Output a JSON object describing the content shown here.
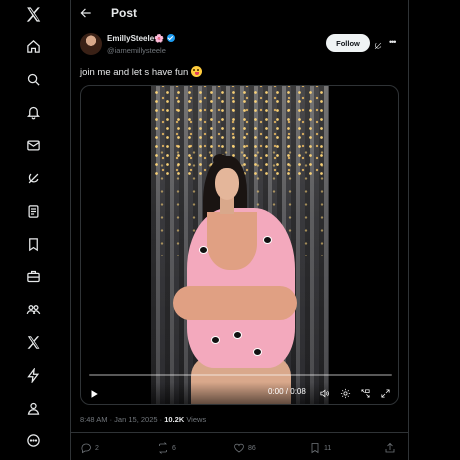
{
  "sidebar": {
    "items": [
      {
        "icon": "x-logo-icon"
      },
      {
        "icon": "home-icon"
      },
      {
        "icon": "search-icon"
      },
      {
        "icon": "notifications-icon"
      },
      {
        "icon": "messages-icon"
      },
      {
        "icon": "grok-icon"
      },
      {
        "icon": "lists-icon"
      },
      {
        "icon": "bookmarks-icon"
      },
      {
        "icon": "jobs-icon"
      },
      {
        "icon": "communities-icon"
      },
      {
        "icon": "premium-icon"
      },
      {
        "icon": "verified-orgs-icon"
      },
      {
        "icon": "profile-icon"
      },
      {
        "icon": "more-icon"
      }
    ]
  },
  "header": {
    "title": "Post"
  },
  "post": {
    "author": {
      "display_name": "EmillySteele",
      "name_emoji": "🌸",
      "handle": "@iamemillysteele",
      "verified": true
    },
    "follow_label": "Follow",
    "text": "join me and let s have fun",
    "video": {
      "current_time": "0:00",
      "duration": "0:08",
      "time_label": "0:00 / 0:08",
      "progress": 0.0
    },
    "timestamp": "8:48 AM · Jan 15, 2025 · ",
    "views_count": "10.2K",
    "views_label": " Views",
    "stats": {
      "replies": "2",
      "reposts": "6",
      "likes": "86",
      "bookmarks": "11"
    }
  },
  "colors": {
    "background": "#000000",
    "text_primary": "#e7e9ea",
    "text_secondary": "#71767b",
    "accent": "#1d9bf0",
    "border": "#2f3336"
  }
}
